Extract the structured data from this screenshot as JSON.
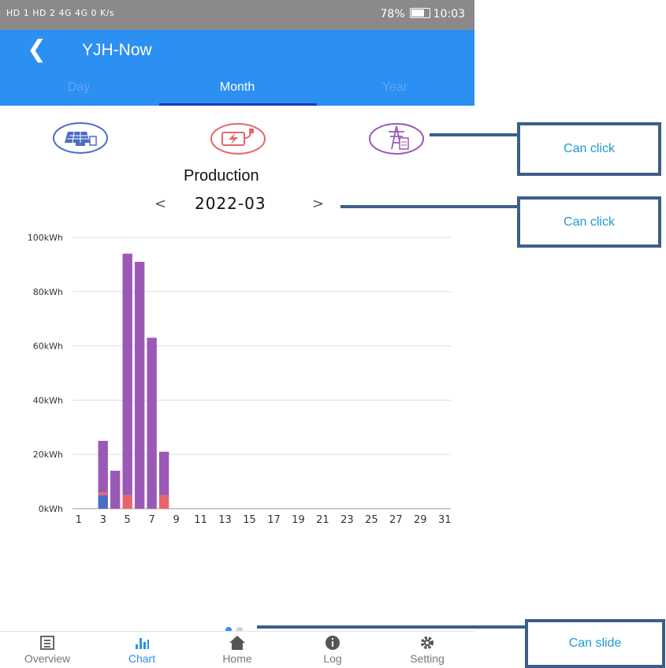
{
  "status_bar": {
    "signal": "HD 1 HD 2  4G 4G  0 K/s",
    "battery": "78%",
    "time": "10:03"
  },
  "header": {
    "title": "YJH-Now"
  },
  "tabs": [
    {
      "label": "Day"
    },
    {
      "label": "Month"
    },
    {
      "label": "Year"
    }
  ],
  "chart_header": {
    "title": "Production",
    "period": "2022-03",
    "prev": "<",
    "next": ">"
  },
  "colors": {
    "primary": "#2c8ff2",
    "purple": "#9b59b6",
    "red": "#e8646c",
    "blue": "#4a6cc8"
  },
  "chart_data": {
    "type": "bar",
    "title": "Production",
    "y_tick_labels": [
      "0kWh",
      "20kWh",
      "40kWh",
      "60kWh",
      "80kWh",
      "100kWh"
    ],
    "ylim": [
      0,
      100
    ],
    "x_tick_labels": [
      "1",
      "3",
      "5",
      "7",
      "9",
      "11",
      "13",
      "15",
      "17",
      "19",
      "21",
      "23",
      "25",
      "27",
      "29",
      "31"
    ],
    "categories": [
      1,
      2,
      3,
      4,
      5,
      6,
      7,
      8,
      9,
      10,
      11,
      12,
      13,
      14,
      15,
      16,
      17,
      18,
      19,
      20,
      21,
      22,
      23,
      24,
      25,
      26,
      27,
      28,
      29,
      30,
      31
    ],
    "series": [
      {
        "color": "#4a6cc8",
        "values": [
          0,
          0,
          5,
          0,
          0,
          0,
          0,
          0,
          0,
          0,
          0,
          0,
          0,
          0,
          0,
          0,
          0,
          0,
          0,
          0,
          0,
          0,
          0,
          0,
          0,
          0,
          0,
          0,
          0,
          0,
          0
        ]
      },
      {
        "color": "#e8646c",
        "values": [
          0,
          0,
          1,
          0,
          5,
          0,
          0,
          5,
          0,
          0,
          0,
          0,
          0,
          0,
          0,
          0,
          0,
          0,
          0,
          0,
          0,
          0,
          0,
          0,
          0,
          0,
          0,
          0,
          0,
          0,
          0
        ]
      },
      {
        "color": "#9b59b6",
        "values": [
          0,
          0,
          19,
          14,
          89,
          91,
          63,
          16,
          0,
          0,
          0,
          0,
          0,
          0,
          0,
          0,
          0,
          0,
          0,
          0,
          0,
          0,
          0,
          0,
          0,
          0,
          0,
          0,
          0,
          0,
          0
        ]
      }
    ],
    "grid": true
  },
  "pager": {
    "dots": 2,
    "active_index": 0
  },
  "bottom_nav": [
    {
      "label": "Overview",
      "icon": "overview-icon"
    },
    {
      "label": "Chart",
      "icon": "chart-icon"
    },
    {
      "label": "Home",
      "icon": "home-icon"
    },
    {
      "label": "Log",
      "icon": "log-icon"
    },
    {
      "label": "Setting",
      "icon": "gear-icon"
    }
  ],
  "annotations": [
    {
      "label": "Can click"
    },
    {
      "label": "Can click"
    },
    {
      "label": "Can slide"
    }
  ]
}
